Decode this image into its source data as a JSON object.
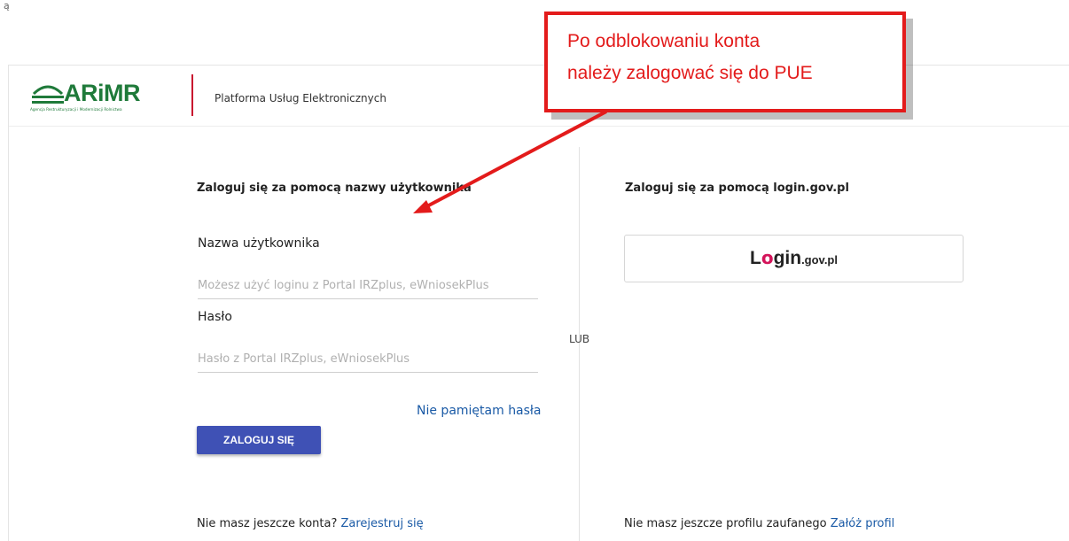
{
  "top_glyph": "ą",
  "header": {
    "logo_text": "ARiMR",
    "logo_subtitle": "Agencja Restrukturyzacji i Modernizacji Rolnictwa",
    "platform_name": "Platforma Usług Elektronicznych"
  },
  "left": {
    "title": "Zaloguj się za pomocą nazwy użytkownika",
    "username_label": "Nazwa użytkownika",
    "username_placeholder": "Możesz użyć loginu z Portal IRZplus, eWniosekPlus",
    "password_label": "Hasło",
    "password_placeholder": "Hasło z Portal IRZplus, eWniosekPlus",
    "forgot_password": "Nie pamiętam hasła",
    "login_button": "ZALOGUJ SIĘ",
    "no_account_text": "Nie masz jeszcze konta?",
    "register_link": "Zarejestruj się"
  },
  "separator": "LUB",
  "right": {
    "title": "Zaloguj się za pomocą login.gov.pl",
    "gov_logo": {
      "prefix": "L",
      "o": "o",
      "rest": "gin",
      "suffix": ".gov.pl"
    },
    "no_profile_text": "Nie masz jeszcze profilu zaufanego",
    "create_profile_link": "Załóż profil"
  },
  "callout": {
    "line1": "Po odblokowaniu konta",
    "line2": "należy zalogować się do PUE"
  },
  "colors": {
    "brand_green": "#1f7a3a",
    "accent_red": "#c8102e",
    "callout_red": "#e31b1b",
    "button_blue": "#3f51b5",
    "link_blue": "#1a5aa6"
  }
}
